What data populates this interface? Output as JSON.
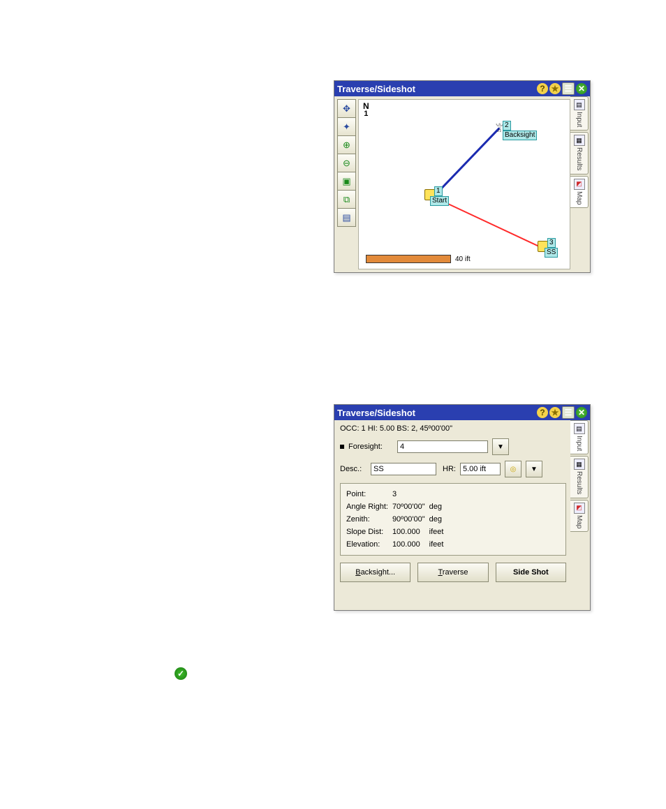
{
  "window_title": "Traverse/Sideshot",
  "titlebar_icons": {
    "help": "?",
    "star": "★",
    "pref": "☰",
    "close": "✕"
  },
  "side_tabs": [
    {
      "id": "input",
      "label": "Input",
      "icon": "frm"
    },
    {
      "id": "results",
      "label": "Results",
      "icon": "tbl"
    },
    {
      "id": "map",
      "label": "Map",
      "icon": "xy"
    }
  ],
  "panelA": {
    "active_tab": "map",
    "toolbar": [
      {
        "name": "pan",
        "glyph": "✥"
      },
      {
        "name": "extents",
        "glyph": "✦"
      },
      {
        "name": "zoom-in",
        "glyph": "⊕"
      },
      {
        "name": "zoom-out",
        "glyph": "⊖"
      },
      {
        "name": "zoom-win",
        "glyph": "▣"
      },
      {
        "name": "zoom-prev",
        "glyph": "⧉"
      },
      {
        "name": "layers",
        "glyph": "▤"
      }
    ],
    "compass": {
      "dir": "N",
      "sub": "1"
    },
    "scale_text": "40 ift",
    "points": {
      "p1": {
        "num": "1",
        "desc": "Start"
      },
      "p2": {
        "num": "2",
        "desc": "Backsight"
      },
      "p3": {
        "num": "3",
        "desc": "SS"
      }
    }
  },
  "panelB": {
    "active_tab": "input",
    "status": "OCC: 1  HI: 5.00  BS: 2, 45º00'00\"",
    "labels": {
      "foresight": "Foresight:",
      "desc": "Desc.:",
      "hr": "HR:"
    },
    "inputs": {
      "foresight_value": "4",
      "desc_value": "SS",
      "hr_value": "5.00 ift"
    },
    "results": {
      "rows": [
        {
          "k": "Point:",
          "v": "3",
          "u": ""
        },
        {
          "k": "Angle Right:",
          "v": "70º00'00\"",
          "u": "deg"
        },
        {
          "k": "Zenith:",
          "v": "90º00'00\"",
          "u": "deg"
        },
        {
          "k": "Slope Dist:",
          "v": "100.000",
          "u": "ifeet"
        },
        {
          "k": "Elevation:",
          "v": "100.000",
          "u": "ifeet"
        }
      ]
    },
    "buttons": {
      "backsight": "Backsight...",
      "traverse": "Traverse",
      "sideshot": "Side Shot"
    }
  }
}
